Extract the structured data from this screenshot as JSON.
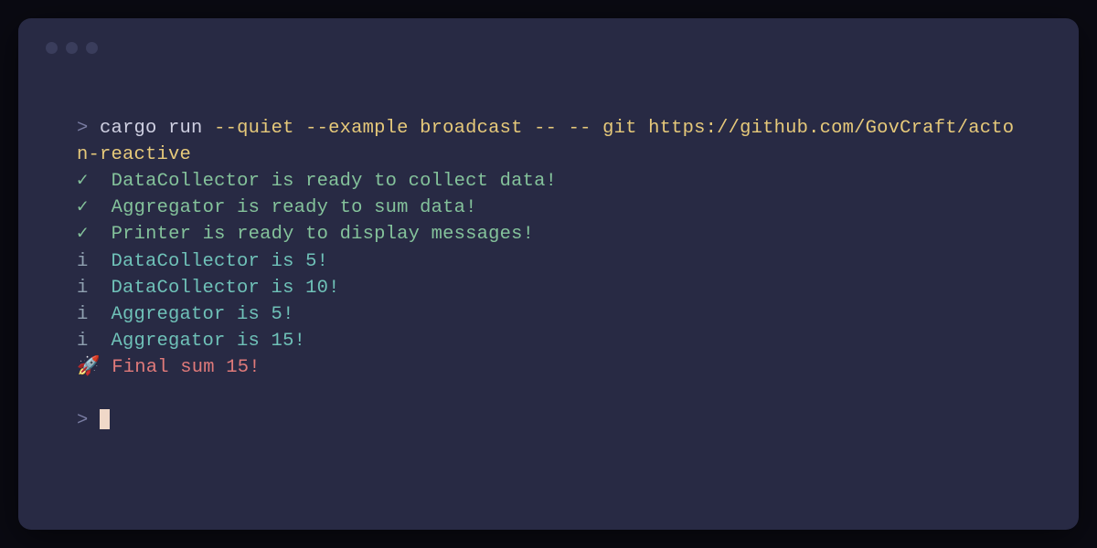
{
  "window": {
    "traffic_lights": [
      "close",
      "minimize",
      "maximize"
    ]
  },
  "prompt_symbol": ">",
  "command": {
    "part1": "cargo run ",
    "part2": "--quiet --example broadcast -- -- git https://github.com/GovCraft/acton-reactive"
  },
  "output_lines": [
    {
      "icon": "✓",
      "icon_class": "check",
      "text": " DataCollector is ready to collect data!",
      "text_class": "msg-green"
    },
    {
      "icon": "✓",
      "icon_class": "check",
      "text": " Aggregator is ready to sum data!",
      "text_class": "msg-green"
    },
    {
      "icon": "✓",
      "icon_class": "check",
      "text": " Printer is ready to display messages!",
      "text_class": "msg-green"
    },
    {
      "icon": "i",
      "icon_class": "info",
      "text": " DataCollector is 5!",
      "text_class": "msg-teal"
    },
    {
      "icon": "i",
      "icon_class": "info",
      "text": " DataCollector is 10!",
      "text_class": "msg-teal"
    },
    {
      "icon": "i",
      "icon_class": "info",
      "text": " Aggregator is 5!",
      "text_class": "msg-teal"
    },
    {
      "icon": "i",
      "icon_class": "info",
      "text": " Aggregator is 15!",
      "text_class": "msg-teal"
    },
    {
      "icon": "🚀",
      "icon_class": "rocket",
      "text": "Final sum 15!",
      "text_class": "msg-red"
    }
  ],
  "colors": {
    "bg_outer": "#0a0a12",
    "bg_terminal": "#282a44",
    "prompt": "#7a7da3",
    "cmd_base": "#cfd0e2",
    "cmd_yellow": "#e6c97a",
    "green": "#84c29b",
    "teal": "#6fc1b8",
    "red": "#e07a7a",
    "info_grey": "#8fa0b0",
    "cursor": "#f0d8c8"
  }
}
